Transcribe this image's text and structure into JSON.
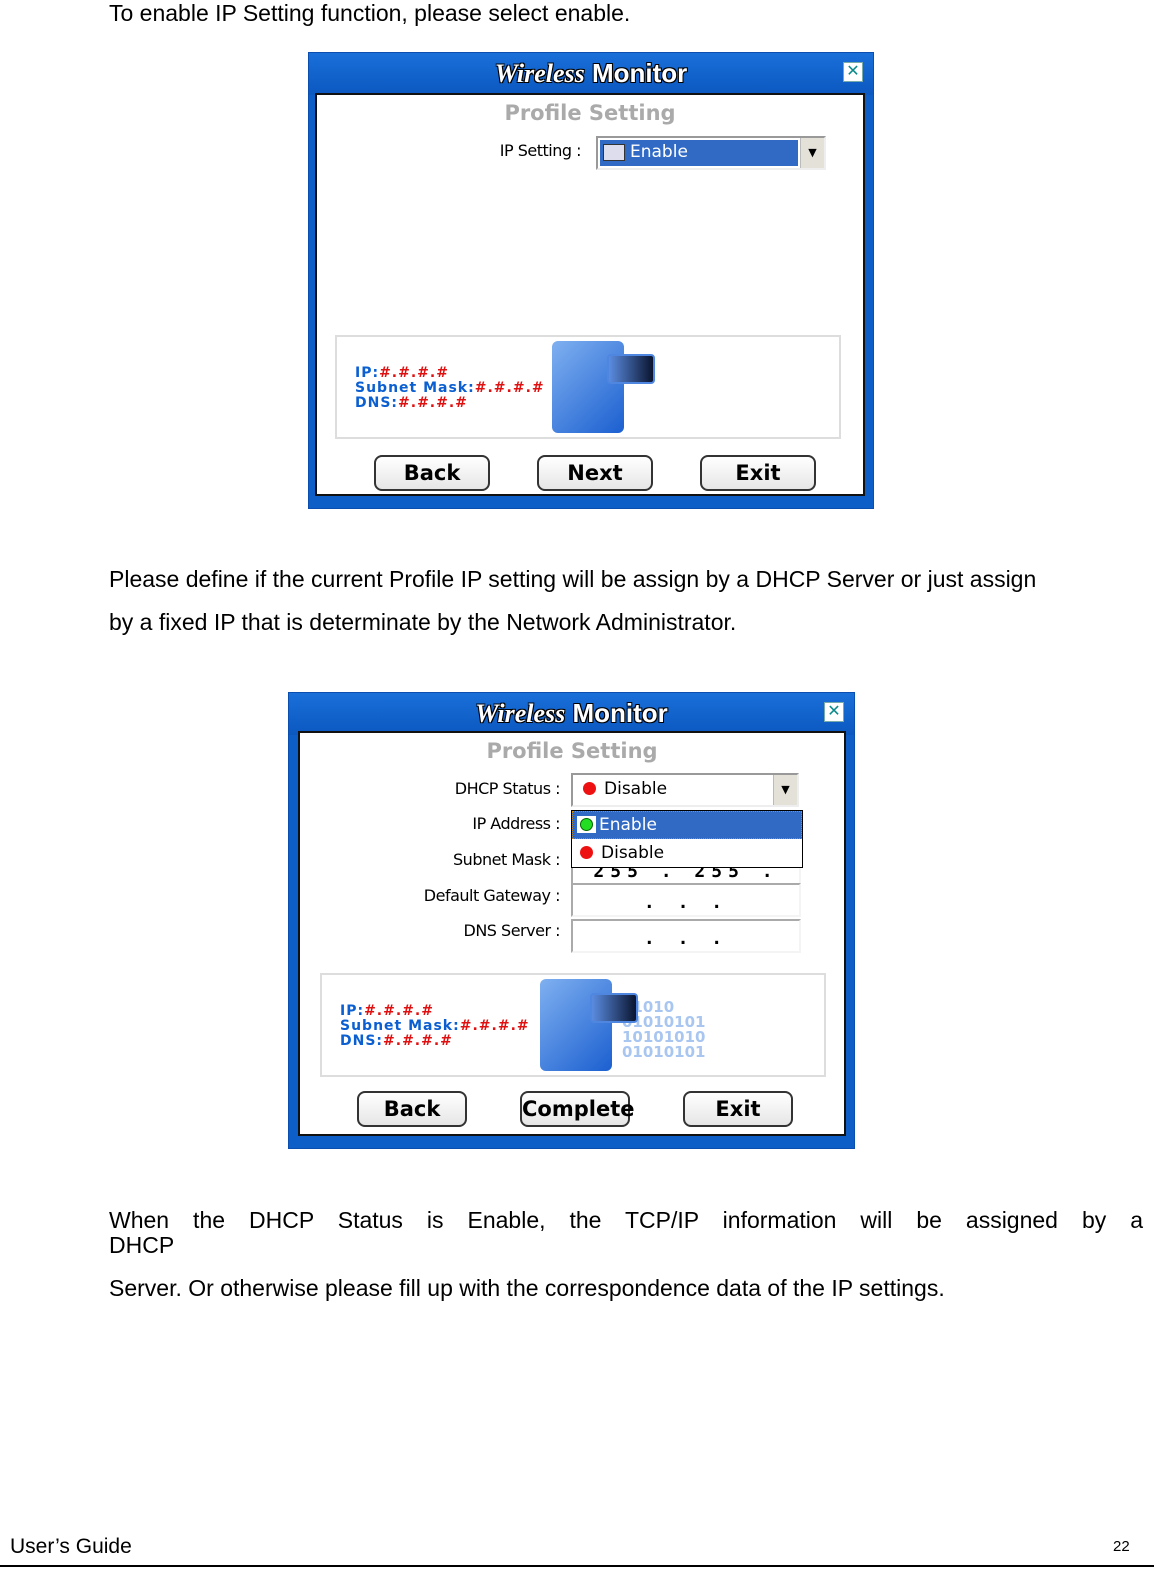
{
  "intro": "To enable IP Setting function, please select enable.",
  "dialog1": {
    "title_italic": "Wireless",
    "title_bold": "Monitor",
    "heading": "Profile Setting",
    "ip_setting_label": "IP Setting :",
    "ip_setting_value": "Enable",
    "info": {
      "ip_label": "IP:",
      "ip_value": "#.#.#.#",
      "mask_label": "Subnet Mask:",
      "mask_value": "#.#.#.#",
      "dns_label": "DNS:",
      "dns_value": "#.#.#.#"
    },
    "buttons": {
      "back": "Back",
      "next": "Next",
      "exit": "Exit"
    }
  },
  "para2_line1": "Please define if the current Profile IP setting will be assign by a DHCP Server or just assign",
  "para2_line2": "by a fixed IP that is determinate by the Network Administrator.",
  "dialog2": {
    "title_italic": "Wireless",
    "title_bold": "Monitor",
    "heading": "Profile Setting",
    "dhcp_label": "DHCP Status :",
    "dhcp_value": "Disable",
    "dropdown_options": [
      "Enable",
      "Disable"
    ],
    "ip_label": "IP Address :",
    "mask_label": "Subnet Mask :",
    "mask_value": "255 . 255 . 255 .  0",
    "gateway_label": "Default Gateway :",
    "gateway_value": ".   .   .",
    "dns_label": "DNS Server :",
    "dns_value": ".   .   .",
    "info": {
      "ip_label": "IP:",
      "ip_value": "#.#.#.#",
      "mask_label": "Subnet Mask:",
      "mask_value": "#.#.#.#",
      "dns_label": "DNS:",
      "dns_value": "#.#.#.#"
    },
    "binary": [
      "01010",
      "01010101",
      "10101010",
      "01010101"
    ],
    "buttons": {
      "back": "Back",
      "complete": "Complete",
      "exit": "Exit"
    },
    "colors": {
      "enable_dot": "#22dd22",
      "disable_dot": "#ee1111",
      "selection": "#316ac5"
    }
  },
  "para3_line1": "When the DHCP Status is Enable, the TCP/IP information will be assigned by a DHCP",
  "para3_line2": "Server. Or otherwise please fill up with the correspondence data of the IP settings.",
  "footer": {
    "left": "User’s Guide",
    "page": "22"
  }
}
